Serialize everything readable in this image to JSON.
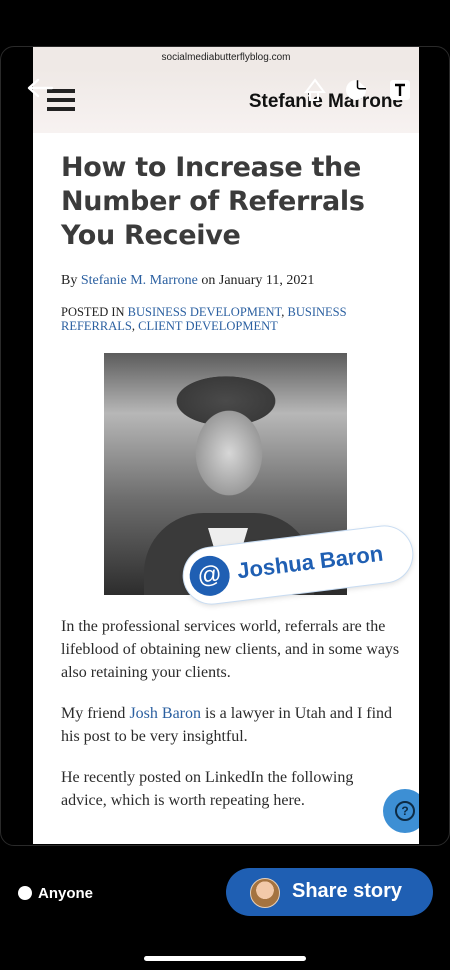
{
  "browser": {
    "url": "socialmediabutterflyblog.com"
  },
  "site": {
    "brand": "Stefanie Marrone"
  },
  "article": {
    "title": "How to Increase the Number of Referrals You Receive",
    "by_prefix": "By",
    "author": "Stefanie M. Marrone",
    "date_prefix": "on",
    "date": "January 11, 2021",
    "posted_in_prefix": "POSTED IN",
    "categories": [
      "BUSINESS DEVELOPMENT",
      "BUSINESS REFERRALS",
      "CLIENT DEVELOPMENT"
    ],
    "paragraph1": "In the professional services world, referrals are the lifeblood of obtaining new clients, and in some ways also retaining your clients.",
    "p2_before": "My friend",
    "p2_link": "Josh Baron",
    "p2_after": "is a lawyer in Utah and I find his post to be very insightful.",
    "paragraph3": "He recently posted on LinkedIn the following advice, which is worth repeating here."
  },
  "mention_sticker": {
    "symbol": "@",
    "name": "Joshua Baron"
  },
  "help": {
    "symbol": "?"
  },
  "footer": {
    "audience": "Anyone",
    "share_label": "Share story"
  }
}
